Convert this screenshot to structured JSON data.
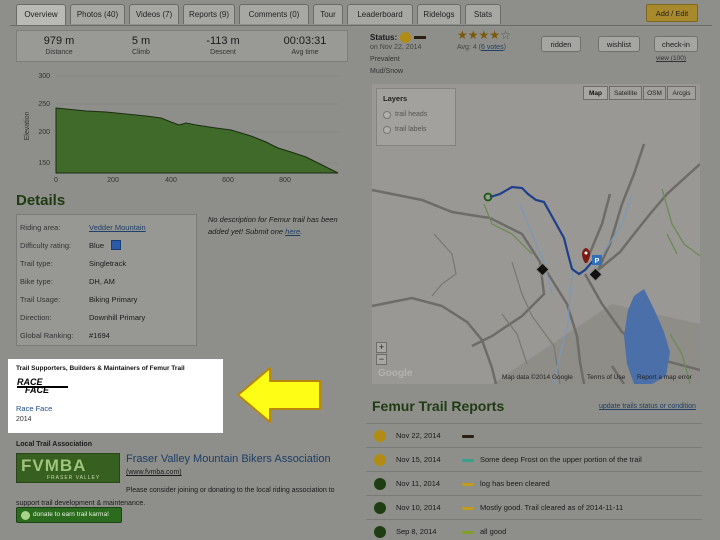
{
  "tabs": [
    {
      "label": "Overview",
      "active": true
    },
    {
      "label": "Photos (40)"
    },
    {
      "label": "Videos (7)"
    },
    {
      "label": "Reports (9)"
    },
    {
      "label": "Comments (0)"
    },
    {
      "label": "Tour"
    },
    {
      "label": "Leaderboard"
    },
    {
      "label": "Ridelogs"
    },
    {
      "label": "Stats"
    }
  ],
  "add_edit": "Add / Edit",
  "stats": [
    {
      "value": "979 m",
      "label": "Distance"
    },
    {
      "value": "5 m",
      "label": "Climb"
    },
    {
      "value": "-113 m",
      "label": "Descent"
    },
    {
      "value": "00:03:31",
      "label": "Avg time"
    }
  ],
  "elevation_chart": {
    "ylabel": "Elevation",
    "yticks": [
      "300",
      "250",
      "200",
      "150"
    ],
    "xticks": [
      "0",
      "200",
      "400",
      "600",
      "800"
    ]
  },
  "details": {
    "heading": "Details",
    "rows": [
      {
        "label": "Riding area:",
        "value": "Vedder Mountain",
        "link": true
      },
      {
        "label": "Difficulty rating:",
        "value": "Blue"
      },
      {
        "label": "Trail type:",
        "value": "Singletrack"
      },
      {
        "label": "Bike type:",
        "value": "DH, AM"
      },
      {
        "label": "Trail Usage:",
        "value": "Biking Primary"
      },
      {
        "label": "Direction:",
        "value": "Downhill Primary"
      },
      {
        "label": "Global Ranking:",
        "value": "#1694"
      }
    ],
    "no_description": "No description for Femur trail has been added yet! Submit one",
    "no_description_link": "here",
    "no_description_end": "."
  },
  "supporters": {
    "title": "Trail Supporters, Builders & Maintainers of Femur Trail",
    "logo_text_1": "RACE",
    "logo_text_2": "FACE",
    "name": "Race Face",
    "year": "2014"
  },
  "association": {
    "heading": "Local Trail Association",
    "logo_text": "FVMBA",
    "logo_sub": "FRASER VALLEY",
    "name": "Fraser Valley Mountain Bikers Association",
    "url": "(www.fvmba.com)",
    "description": "Please consider joining or donating to the local riding association to support trail development & maintenance.",
    "donate": "donate to earn trail karma!"
  },
  "status": {
    "label": "Status:",
    "date": "on Nov 22, 2014",
    "prevalent": "Prevalent",
    "condition": "Mud/Snow"
  },
  "rating": {
    "stars": 4,
    "max": 5,
    "avg": "Avg: 4 (",
    "votes": "6 votes",
    "avg_end": ")"
  },
  "buttons": {
    "ridden": "ridden",
    "wishlist": "wishlist",
    "checkin": "check-in",
    "view": "view (100)"
  },
  "map": {
    "layers_title": "Layers",
    "layers": [
      "trail heads",
      "trail labels"
    ],
    "types": [
      "Map",
      "Satellite",
      "OSM",
      "Arcgis"
    ],
    "zoom_in": "+",
    "zoom_out": "−",
    "google": "Google",
    "attribution": "Map data ©2014 Google",
    "terms": "Terms of Use",
    "report": "Report a map error",
    "parking": "P"
  },
  "reports": {
    "title": "Femur Trail Reports",
    "update_link": "update trails status or condition",
    "items": [
      {
        "date": "Nov 22, 2014",
        "text": "",
        "dot": "#b08c14",
        "bar": "#2b1f12"
      },
      {
        "date": "Nov 15, 2014",
        "text": "Some deep Frost on the upper portion of the trail",
        "dot": "#b08c14",
        "bar": "#3aa08a"
      },
      {
        "date": "Nov 11, 2014",
        "text": "log has been cleared",
        "dot": "#1f3d12",
        "bar": "#c39a1d"
      },
      {
        "date": "Nov 10, 2014",
        "text": "Mostly good. Trail cleared as of 2014-11-11",
        "dot": "#1f3d12",
        "bar": "#c39a1d"
      },
      {
        "date": "Sep 8, 2014",
        "text": "all good",
        "dot": "#1f3d12",
        "bar": "#7fa12a"
      }
    ]
  },
  "colors": {
    "page_dim": "#8e8e8a",
    "highlight": "#ffffff",
    "arrow_fill": "#fdfd16",
    "arrow_stroke": "#b8860b",
    "difficulty_blue": "#2a5aa8",
    "elevation_fill": "#3f6a2a"
  }
}
